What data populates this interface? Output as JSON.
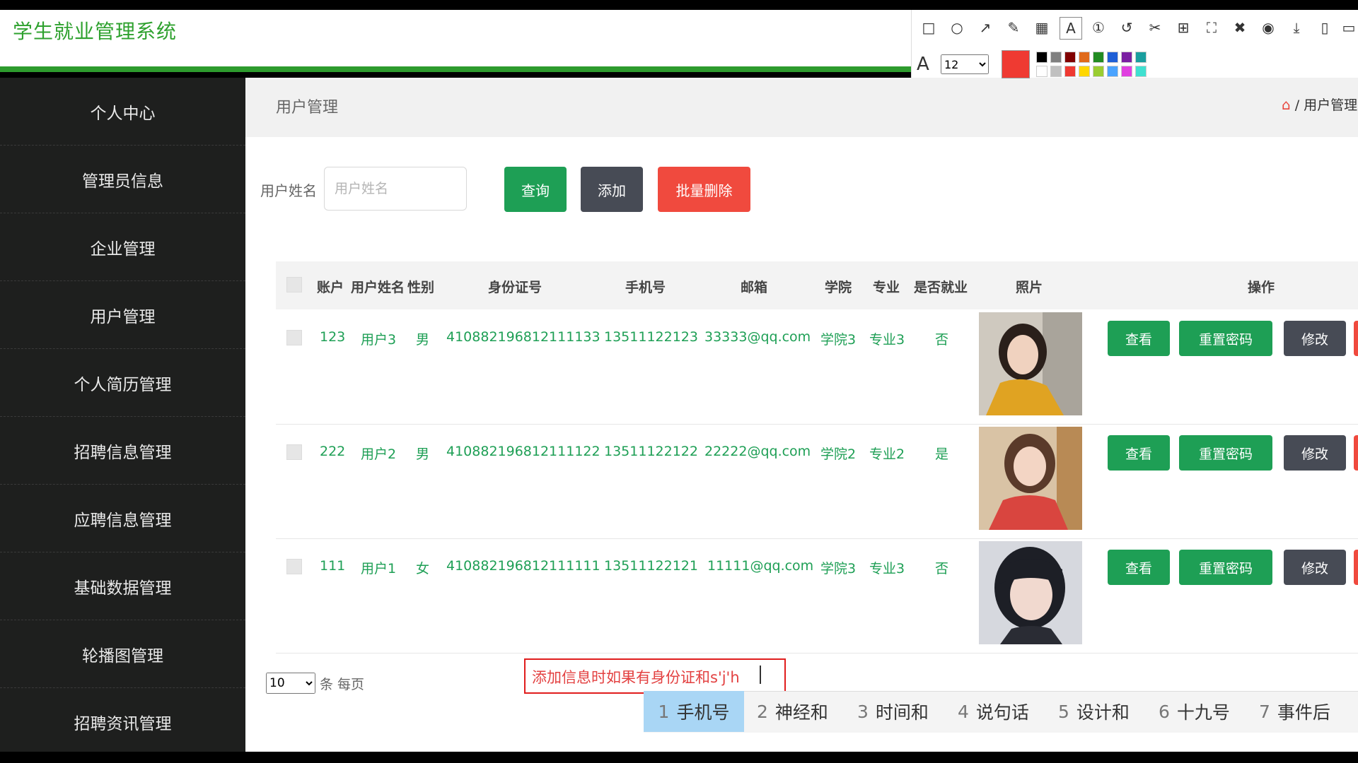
{
  "app": {
    "title": "学生就业管理系统"
  },
  "sidebar": {
    "items": [
      {
        "label": "个人中心"
      },
      {
        "label": "管理员信息"
      },
      {
        "label": "企业管理"
      },
      {
        "label": "用户管理"
      },
      {
        "label": "个人简历管理"
      },
      {
        "label": "招聘信息管理"
      },
      {
        "label": "应聘信息管理"
      },
      {
        "label": "基础数据管理"
      },
      {
        "label": "轮播图管理"
      },
      {
        "label": "招聘资讯管理"
      }
    ]
  },
  "page": {
    "title": "用户管理",
    "breadcrumb_separator": "/",
    "breadcrumb_current": "用户管理"
  },
  "search": {
    "label": "用户姓名",
    "placeholder": "用户姓名",
    "query_label": "查询",
    "add_label": "添加",
    "batch_delete_label": "批量删除"
  },
  "table": {
    "columns": [
      "账户",
      "用户姓名",
      "性别",
      "身份证号",
      "手机号",
      "邮箱",
      "学院",
      "专业",
      "是否就业",
      "照片",
      "操作"
    ],
    "rows": [
      {
        "account": "123",
        "name": "用户3",
        "gender": "男",
        "id_card": "410882196812111133",
        "phone": "13511122123",
        "email": "33333@qq.com",
        "college": "学院3",
        "major": "专业3",
        "employed": "否",
        "photo": "photo-yellow-sweater"
      },
      {
        "account": "222",
        "name": "用户2",
        "gender": "男",
        "id_card": "410882196812111122",
        "phone": "13511122122",
        "email": "22222@qq.com",
        "college": "学院2",
        "major": "专业2",
        "employed": "是",
        "photo": "photo-red-shirt"
      },
      {
        "account": "111",
        "name": "用户1",
        "gender": "女",
        "id_card": "410882196812111111",
        "phone": "13511122121",
        "email": "11111@qq.com",
        "college": "学院3",
        "major": "专业3",
        "employed": "否",
        "photo": "photo-short-hair"
      }
    ],
    "row_actions": {
      "view": "查看",
      "reset_password": "重置密码",
      "edit": "修改"
    }
  },
  "pagination": {
    "page_size": "10",
    "per_page_label": "条 每页"
  },
  "ime": {
    "input_text": "添加信息时如果有身份证和s'j'h",
    "candidates": [
      {
        "num": "1",
        "text": "手机号",
        "selected": true
      },
      {
        "num": "2",
        "text": "神经和"
      },
      {
        "num": "3",
        "text": "时间和"
      },
      {
        "num": "4",
        "text": "说句话"
      },
      {
        "num": "5",
        "text": "设计和"
      },
      {
        "num": "6",
        "text": "十九号"
      },
      {
        "num": "7",
        "text": "事件后"
      }
    ]
  },
  "snip_toolbar": {
    "icons": [
      "rectangle-icon",
      "ellipse-icon",
      "arrow-icon",
      "pencil-icon",
      "mosaic-icon",
      "text-icon",
      "number-icon",
      "undo-icon",
      "crop-icon",
      "translate-icon",
      "ocr-icon",
      "pin-icon",
      "record-icon",
      "download-icon",
      "copy-icon",
      "close-icon"
    ],
    "font_size": "12",
    "current_color": "#ef3a32",
    "swatches": [
      "#000000",
      "#808080",
      "#800000",
      "#e06a1b",
      "#228b22",
      "#1f5fd6",
      "#7a1fa2",
      "#1a9e9e",
      "#ffffff",
      "#c0c0c0",
      "#ef3a32",
      "#ffd700",
      "#9acd32",
      "#4aa3ff",
      "#e040e0",
      "#40e0d0"
    ]
  },
  "colors": {
    "brand_green": "#2ea12e",
    "button_green": "#1e9f55",
    "button_dark": "#474b55",
    "button_red": "#f04a3e",
    "sidebar_bg": "#1e1f1e"
  }
}
